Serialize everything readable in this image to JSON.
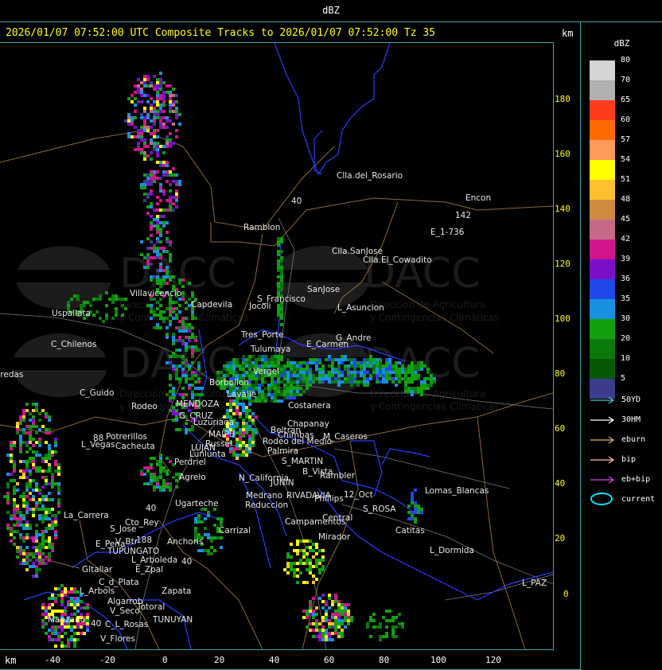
{
  "window": {
    "title": "dBZ"
  },
  "header": {
    "text": "2026/01/07 07:52:00 UTC Composite Tracks to 2026/01/07 07:52:00 Tz 35",
    "unit_right": "km",
    "unit_bottom": "km"
  },
  "axes": {
    "y_ticks": [
      "180",
      "160",
      "140",
      "120",
      "100",
      "80",
      "60",
      "40",
      "20",
      "0"
    ],
    "x_ticks": [
      "-40",
      "-20",
      "0",
      "20",
      "40",
      "60",
      "80",
      "100",
      "120"
    ]
  },
  "legend": {
    "title": "dBZ",
    "scale": [
      {
        "label": "80",
        "color": "#d4d4d4"
      },
      {
        "label": "70",
        "color": "#b0b0b0"
      },
      {
        "label": "65",
        "color": "#ff3c1e"
      },
      {
        "label": "60",
        "color": "#ff6a00"
      },
      {
        "label": "57",
        "color": "#ff9a5a"
      },
      {
        "label": "54",
        "color": "#ffff00"
      },
      {
        "label": "51",
        "color": "#ffc030"
      },
      {
        "label": "48",
        "color": "#d08a40"
      },
      {
        "label": "45",
        "color": "#c46a88"
      },
      {
        "label": "42",
        "color": "#d0148c"
      },
      {
        "label": "39",
        "color": "#7a10c8"
      },
      {
        "label": "36",
        "color": "#2048e8"
      },
      {
        "label": "35",
        "color": "#1890e0"
      },
      {
        "label": "30",
        "color": "#10a010"
      },
      {
        "label": "20",
        "color": "#0a7a0a"
      },
      {
        "label": "10",
        "color": "#065a06"
      },
      {
        "label": "5",
        "color": "#3c3c8c"
      }
    ],
    "tracks": [
      {
        "label": "50YD",
        "color": "#40d0d0"
      },
      {
        "label": "30HM",
        "color": "#ffffff"
      },
      {
        "label": "eburn",
        "color": "#e0b070"
      },
      {
        "label": "bip",
        "color": "#ffc0c0"
      },
      {
        "label": "eb+bip",
        "color": "#e040e0"
      },
      {
        "label": "current",
        "color": "#00e0ff"
      }
    ]
  },
  "watermark": {
    "logo_text": "DACC",
    "line1": "Dirección de Agricultura",
    "line2": "y Contingencias Climáticas"
  },
  "places": [
    {
      "name": "Clla.del_Rosario"
    },
    {
      "name": "Encon"
    },
    {
      "name": "E_1-736"
    },
    {
      "name": "142"
    },
    {
      "name": "Ramblon"
    },
    {
      "name": "Clla.SanJose"
    },
    {
      "name": "Clla.El_Cowadito"
    },
    {
      "name": "Villavicencio"
    },
    {
      "name": "Capdevila"
    },
    {
      "name": "S_Francisco"
    },
    {
      "name": "SanJose"
    },
    {
      "name": "L_Asuncion"
    },
    {
      "name": "Jocoli"
    },
    {
      "name": "Uspallata"
    },
    {
      "name": "C_Chilenos"
    },
    {
      "name": "Tres_Porte"
    },
    {
      "name": "E_Carmen"
    },
    {
      "name": "G_Andre"
    },
    {
      "name": "Tulumaya"
    },
    {
      "name": "Paredas"
    },
    {
      "name": "Borbollon"
    },
    {
      "name": "Vergel"
    },
    {
      "name": "C_Guido"
    },
    {
      "name": "MENDOZA"
    },
    {
      "name": "Lavalle"
    },
    {
      "name": "Rodeo"
    },
    {
      "name": "Costanera"
    },
    {
      "name": "Cacheuta"
    },
    {
      "name": "G_CRUZ"
    },
    {
      "name": "Luzuriaga"
    },
    {
      "name": "MAIPU"
    },
    {
      "name": "Russel"
    },
    {
      "name": "Chapanay"
    },
    {
      "name": "Beltran"
    },
    {
      "name": "Chimbas"
    },
    {
      "name": "M_Caseros"
    },
    {
      "name": "Potrerillos"
    },
    {
      "name": "L_Vegas"
    },
    {
      "name": "LUJAN"
    },
    {
      "name": "Lunlunta"
    },
    {
      "name": "Rodeo del Medio"
    },
    {
      "name": "Palmira"
    },
    {
      "name": "Perdriel"
    },
    {
      "name": "S_MARTIN"
    },
    {
      "name": "Agrelo"
    },
    {
      "name": "B_Vista"
    },
    {
      "name": "Rambler"
    },
    {
      "name": "N_California"
    },
    {
      "name": "JUNIN"
    },
    {
      "name": "12_Oct"
    },
    {
      "name": "Ugarteche"
    },
    {
      "name": "Medrano"
    },
    {
      "name": "RIVADAVIA"
    },
    {
      "name": "Phillips"
    },
    {
      "name": "S_ROSA"
    },
    {
      "name": "Lomas_Blancas"
    },
    {
      "name": "Reduccion"
    },
    {
      "name": "La_Carrera"
    },
    {
      "name": "Cto_Rey"
    },
    {
      "name": "S_Jose"
    },
    {
      "name": "Carrizal"
    },
    {
      "name": "Campamentos"
    },
    {
      "name": "Central"
    },
    {
      "name": "Catitas"
    },
    {
      "name": "E_Pena"
    },
    {
      "name": "V_Btr"
    },
    {
      "name": "Anchoris"
    },
    {
      "name": "TUPUNGATO"
    },
    {
      "name": "Mirador"
    },
    {
      "name": "L_Dormida"
    },
    {
      "name": "L_Arboleda"
    },
    {
      "name": "Gltallar"
    },
    {
      "name": "E_Zpal"
    },
    {
      "name": "C_d_Plata"
    },
    {
      "name": "L_Arbols"
    },
    {
      "name": "Zapata"
    },
    {
      "name": "Algarrob"
    },
    {
      "name": "V_Seco"
    },
    {
      "name": "Totoral"
    },
    {
      "name": "TUNUYAN"
    },
    {
      "name": "Manzano"
    },
    {
      "name": "C_L_Rosas"
    },
    {
      "name": "V_Flores"
    },
    {
      "name": "L_PAZ"
    },
    {
      "name": "40"
    },
    {
      "name": "88"
    },
    {
      "name": "40"
    },
    {
      "name": "188"
    },
    {
      "name": "40"
    },
    {
      "name": "40"
    }
  ]
}
